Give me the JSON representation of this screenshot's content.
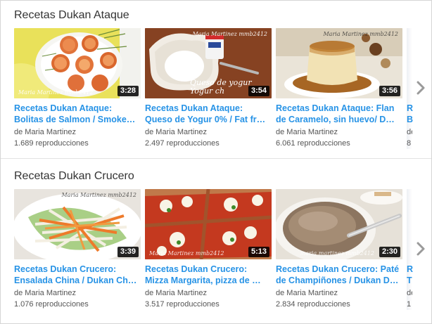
{
  "shelves": [
    {
      "title": "Recetas Dukan Ataque",
      "videos": [
        {
          "title_line1": "Recetas Dukan Ataque:",
          "title_line2": "Bolitas de Salmon / Smoke…",
          "author": "de Maria Martinez",
          "views": "1.689 reproducciones",
          "duration": "3:28",
          "watermark": "Maria Martinez mmb2412",
          "thumb_icon": "salmon-balls-thumbnail"
        },
        {
          "title_line1": "Recetas Dukan Ataque:",
          "title_line2": "Queso de Yogur 0% / Fat fr…",
          "author": "de Maria Martinez",
          "views": "2.497 reproducciones",
          "duration": "3:54",
          "watermark": "Maria Martinez mmb2412",
          "overlay_line1": "Queso de yogur",
          "overlay_line2": "Yogur ch",
          "thumb_icon": "yogurt-cheese-thumbnail"
        },
        {
          "title_line1": "Recetas Dukan Ataque: Flan",
          "title_line2": "de Caramelo, sin huevo/ D…",
          "author": "de Maria Martinez",
          "views": "6.061 reproducciones",
          "duration": "3:56",
          "watermark": "Maria Martinez mmb2412",
          "thumb_icon": "caramel-flan-thumbnail"
        }
      ],
      "partial_card": {
        "title_line1": "Re",
        "title_line2": "Ba",
        "author": "de",
        "views": "8"
      }
    },
    {
      "title": "Recetas Dukan Crucero",
      "videos": [
        {
          "title_line1": "Recetas Dukan Crucero:",
          "title_line2": "Ensalada China / Dukan Ch…",
          "author": "de Maria Martinez",
          "views": "1.076 reproducciones",
          "duration": "3:39",
          "watermark": "Maria Martinez mmb2412",
          "thumb_icon": "chinese-salad-thumbnail"
        },
        {
          "title_line1": "Recetas Dukan Crucero:",
          "title_line2": "Mizza Margarita, pizza de …",
          "author": "de Maria Martinez",
          "views": "3.517 reproducciones",
          "duration": "5:13",
          "watermark": "Maria Martinez mmb2412",
          "thumb_icon": "pizza-thumbnail"
        },
        {
          "title_line1": "Recetas Dukan Crucero: Paté",
          "title_line2": "de Champiñones / Dukan D…",
          "author": "de Maria Martinez",
          "views": "2.834 reproducciones",
          "duration": "2:30",
          "watermark": "maria martinez mmb2412",
          "thumb_icon": "mushroom-pate-thumbnail"
        }
      ],
      "partial_card": {
        "title_line1": "Re",
        "title_line2": "T",
        "author": "de",
        "views": "1"
      }
    }
  ],
  "navigation": {
    "next_icon": "chevron-right-icon"
  },
  "colors": {
    "link": "#2793e6",
    "meta": "#555555",
    "duration_bg": "#000000"
  }
}
